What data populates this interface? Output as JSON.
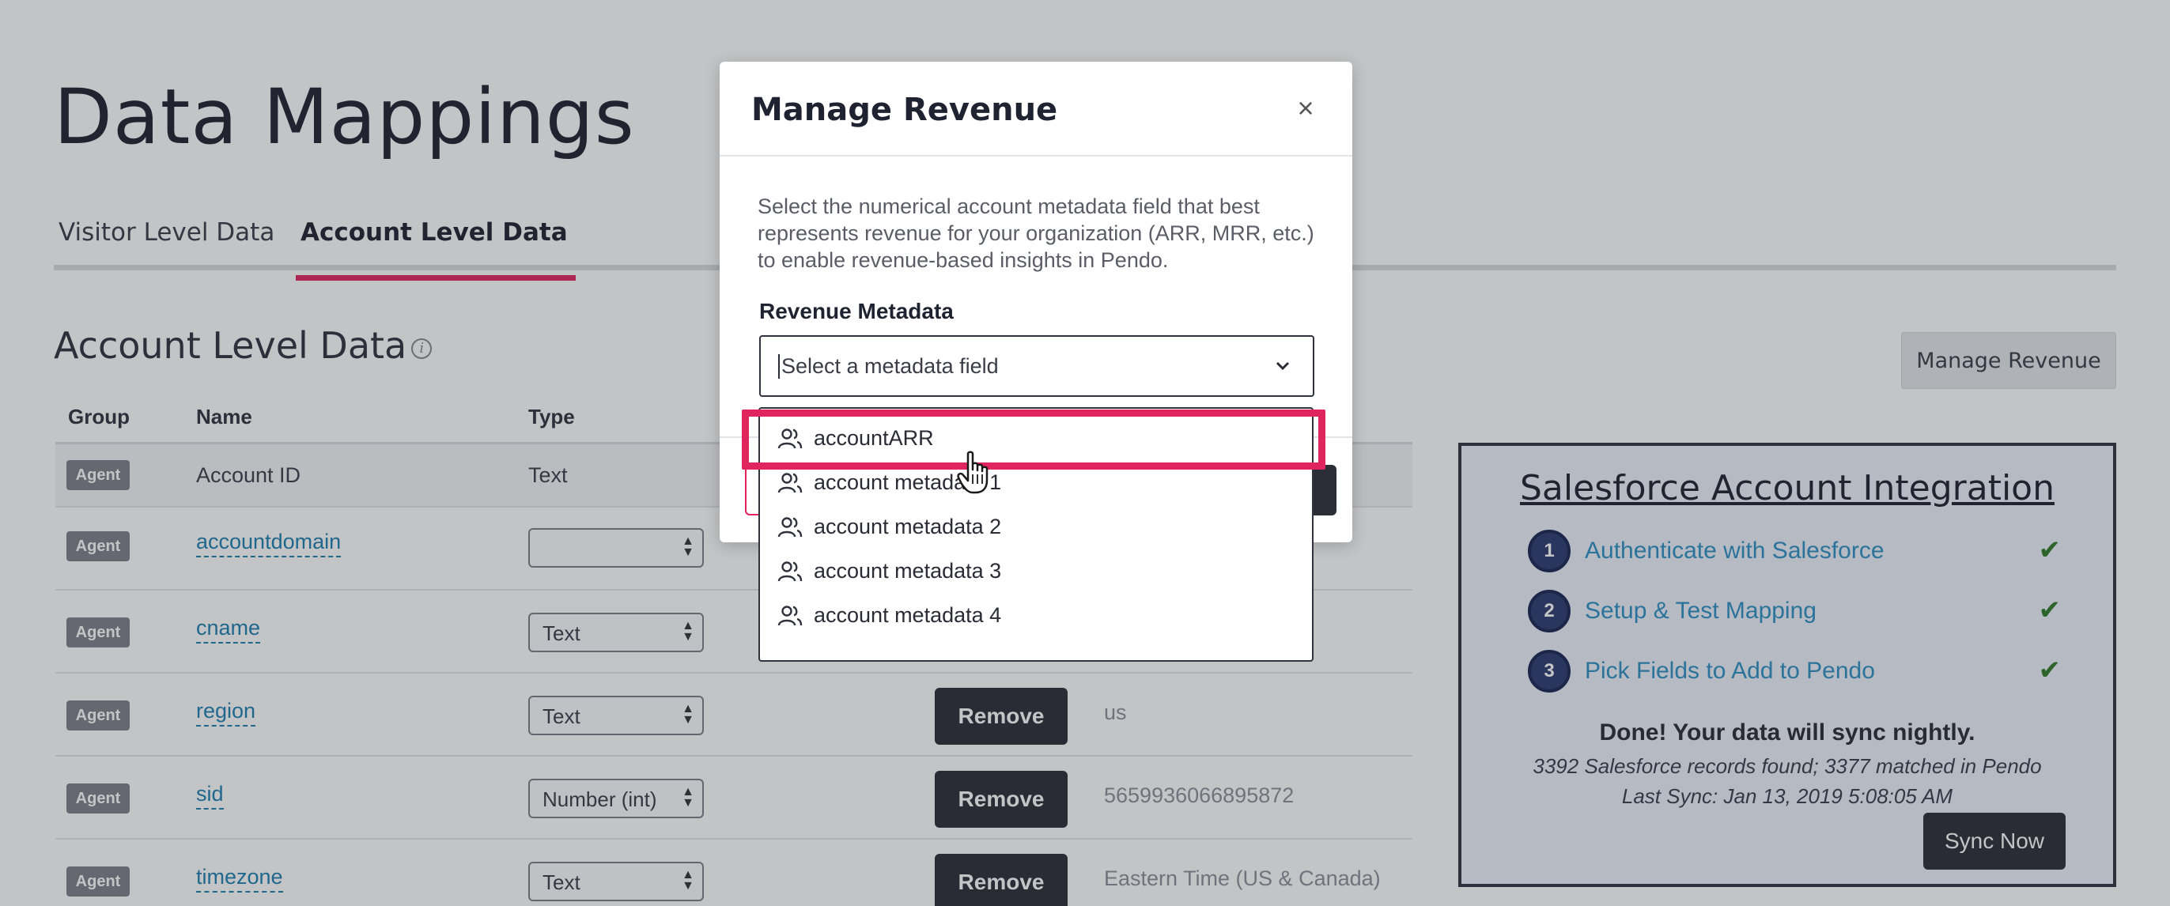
{
  "page": {
    "title": "Data Mappings",
    "tabs": [
      {
        "label": "Visitor Level Data",
        "active": false
      },
      {
        "label": "Account Level Data",
        "active": true
      }
    ],
    "section_title": "Account Level Data",
    "manage_revenue_label": "Manage Revenue"
  },
  "table": {
    "headers": {
      "group": "Group",
      "name": "Name",
      "type": "Type"
    },
    "rows": [
      {
        "group": "Agent",
        "name": "Account ID",
        "type": "Text",
        "value": ""
      },
      {
        "group": "Agent",
        "name": "accountdomain",
        "type": "",
        "value": ""
      },
      {
        "group": "Agent",
        "name": "cname",
        "type": "Text",
        "value": ""
      },
      {
        "group": "Agent",
        "name": "region",
        "type": "Text",
        "remove": "Remove",
        "value": "us"
      },
      {
        "group": "Agent",
        "name": "sid",
        "type": "Number (int)",
        "remove": "Remove",
        "value": "5659936066895872"
      },
      {
        "group": "Agent",
        "name": "timezone",
        "type": "Text",
        "remove": "Remove",
        "value": "Eastern Time (US & Canada)"
      }
    ]
  },
  "salesforce": {
    "title": "Salesforce Account Integration",
    "steps": [
      {
        "num": "1",
        "label": "Authenticate with Salesforce",
        "check": "✔"
      },
      {
        "num": "2",
        "label": "Setup & Test Mapping",
        "check": "✔"
      },
      {
        "num": "3",
        "label": "Pick Fields to Add to Pendo",
        "check": "✔"
      }
    ],
    "done": "Done! Your data will sync nightly.",
    "records": "3392 Salesforce records found; 3377 matched in Pendo",
    "last_sync": "Last Sync: Jan 13, 2019 5:08:05 AM",
    "sync_label": "Sync Now"
  },
  "modal": {
    "title": "Manage Revenue",
    "close": "×",
    "description": "Select the numerical account metadata field that best represents revenue for your organization (ARR, MRR, etc.) to enable revenue-based insights in Pendo.",
    "field_label": "Revenue Metadata",
    "placeholder": "Select a metadata field",
    "options": [
      "accountARR",
      "account metadata 1",
      "account metadata 2",
      "account metadata 3",
      "account metadata 4"
    ]
  },
  "colors": {
    "accent": "#e0245e",
    "link": "#1e7fb0",
    "dark_button": "#2b2d37",
    "check": "#2f7a29"
  }
}
